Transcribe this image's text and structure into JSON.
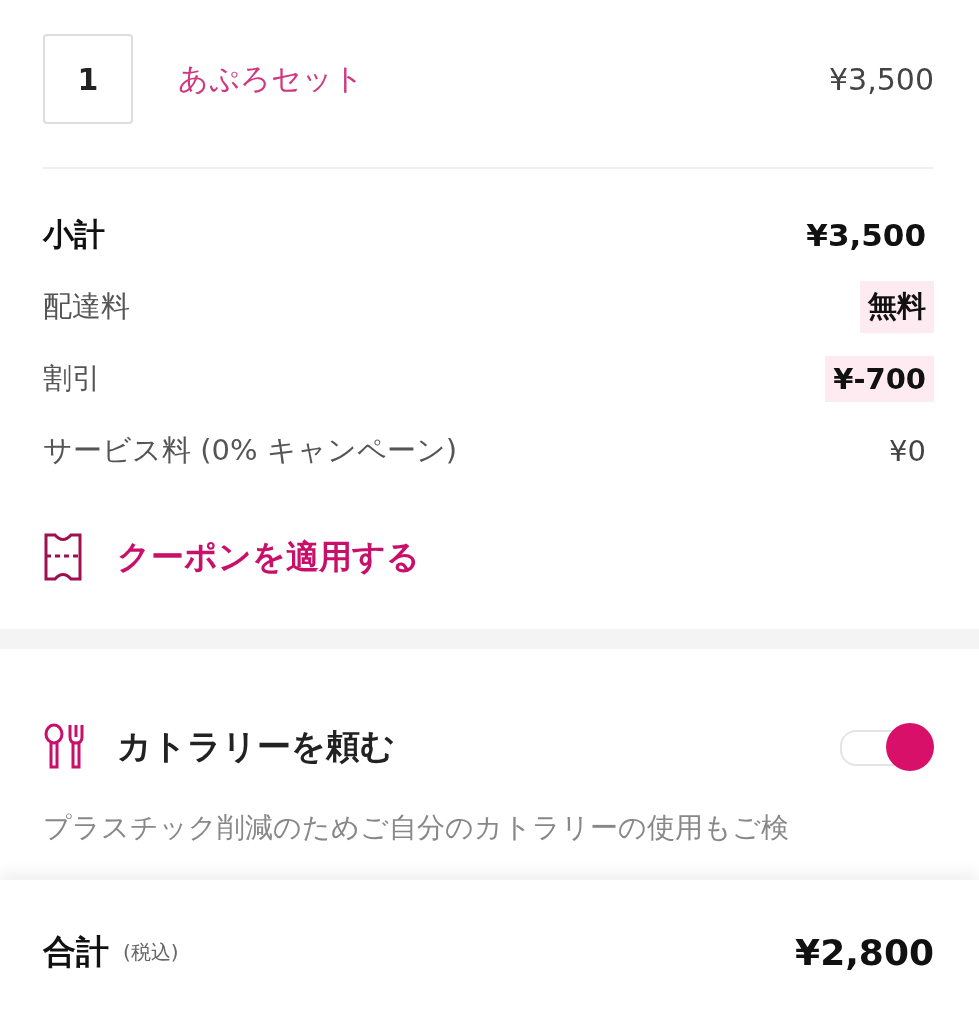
{
  "cart_item": {
    "quantity": "1",
    "name": "あぷろセット",
    "price": "¥3,500"
  },
  "summary": [
    {
      "label": "小計",
      "value": "¥3,500",
      "kind": "main",
      "highlighted": false
    },
    {
      "label": "配達料",
      "value": "無料",
      "kind": "sub",
      "highlighted": true
    },
    {
      "label": "割引",
      "value": "¥-700",
      "kind": "sub",
      "highlighted": true
    },
    {
      "label": "サービス料 (0% キャンペーン)",
      "value": "¥0",
      "kind": "sub",
      "highlighted": false
    }
  ],
  "coupon": {
    "label": "クーポンを適用する"
  },
  "cutlery": {
    "label": "カトラリーを頼む",
    "on": true,
    "note": "プラスチック削減のためご自分のカトラリーの使用もご検"
  },
  "total": {
    "label": "合計",
    "note": "(税込)",
    "value": "¥2,800"
  }
}
